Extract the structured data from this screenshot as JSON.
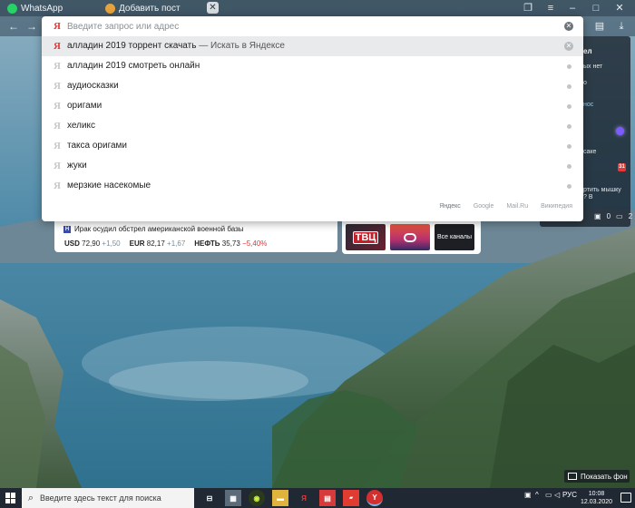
{
  "tabs": [
    {
      "label": "WhatsApp"
    },
    {
      "label": "Добавить пост"
    }
  ],
  "omnibox": {
    "placeholder": "Введите запрос или адрес",
    "logo": "Я",
    "suggestions": [
      {
        "text": "алладин 2019 торрент скачать",
        "extra": " — Искать в Яндексе",
        "active": true
      },
      {
        "text": "алладин 2019 смотреть онлайн"
      },
      {
        "text": "аудиосказки"
      },
      {
        "text": "оригами"
      },
      {
        "text": "хеликс"
      },
      {
        "text": "такса оригами"
      },
      {
        "text": "жуки"
      },
      {
        "text": "мерзкие насекомые"
      }
    ],
    "engines": [
      "Яндекс",
      "Google",
      "Mail.Ru",
      "Википедия"
    ]
  },
  "news": {
    "badge": "Н",
    "headline": "Ирак осудил обстрел американской военной базы",
    "quotes": [
      {
        "label": "USD",
        "value": "72,90",
        "change": "+1,50",
        "dir": "up"
      },
      {
        "label": "EUR",
        "value": "82,17",
        "change": "+1,67",
        "dir": "up"
      },
      {
        "label": "НЕФТЬ",
        "value": "35,73",
        "change": "−5,40%",
        "dir": "down"
      }
    ]
  },
  "tv": {
    "tvc_label": "ТВЦ",
    "all_channels": "Все каналы"
  },
  "sidebar_card": {
    "line1": "ел",
    "line2": "ых нет",
    "line3": "о",
    "line4": "нос",
    "line5": "саке",
    "line6": "ртить мышку",
    "line7": "? В",
    "badge": "31",
    "count_photos": "0",
    "count_comments": "2"
  },
  "desktop": {
    "show_background": "Показать фон"
  },
  "taskbar": {
    "search_placeholder": "Введите здесь текст для поиска",
    "language": "РУС",
    "time": "10:08",
    "date": "12.03.2020"
  },
  "colors": {
    "yandex_red": "#e53935",
    "taskbar": "#1f2833",
    "quote_down": "#d93b3b"
  }
}
